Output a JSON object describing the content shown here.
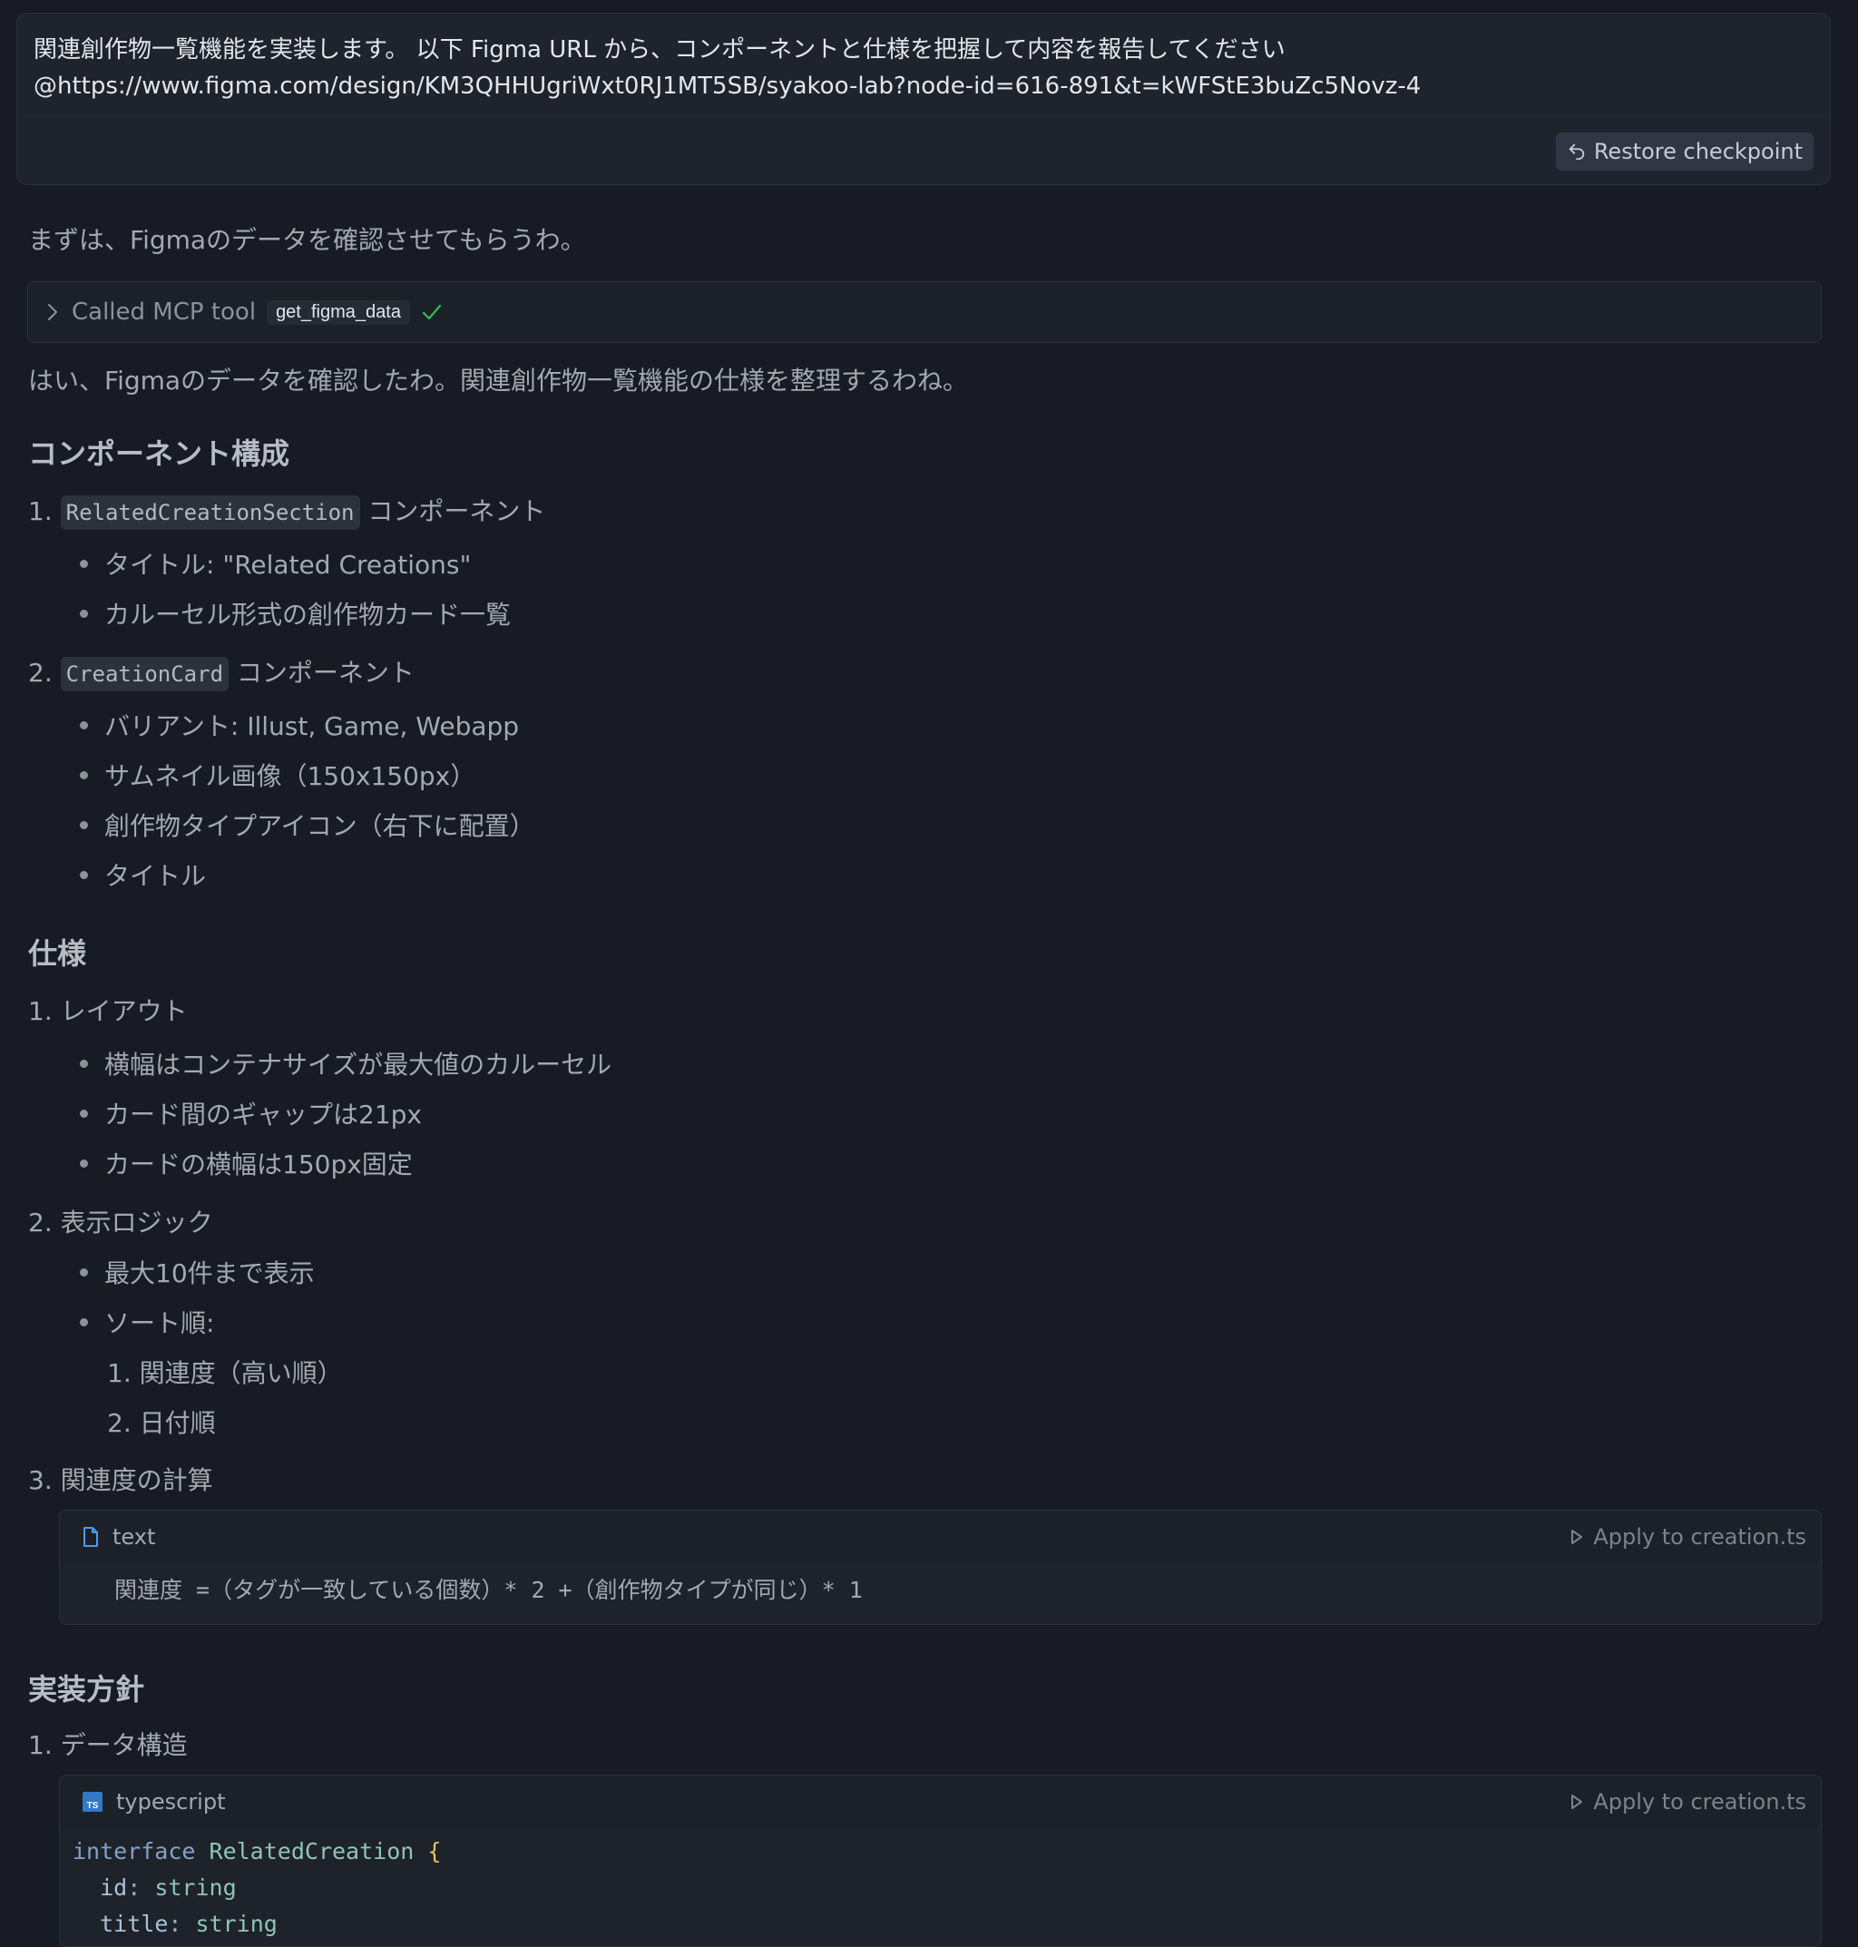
{
  "prompt": {
    "line1": "関連創作物一覧機能を実装します。 以下 Figma URL から、コンポーネントと仕様を把握して内容を報告してください",
    "line2": "@https://www.figma.com/design/KM3QHHUgriWxt0RJ1MT5SB/syakoo-lab?node-id=616-891&t=kWFStE3buZc5Novz-4",
    "restore_label": "Restore checkpoint"
  },
  "intro": "まずは、Figmaのデータを確認させてもらうわ。",
  "mcp": {
    "label": "Called MCP tool",
    "tool": "get_figma_data"
  },
  "confirm": "はい、Figmaのデータを確認したわ。関連創作物一覧機能の仕様を整理するわね。",
  "section1": {
    "heading": "コンポーネント構成",
    "item1": {
      "num": "1.",
      "code": "RelatedCreationSection",
      "suffix": " コンポーネント",
      "bullets": [
        "タイトル: \"Related Creations\"",
        "カルーセル形式の創作物カード一覧"
      ]
    },
    "item2": {
      "num": "2.",
      "code": "CreationCard",
      "suffix": " コンポーネント",
      "bullets": [
        "バリアント: Illust, Game, Webapp",
        "サムネイル画像（150x150px）",
        "創作物タイプアイコン（右下に配置）",
        "タイトル"
      ]
    }
  },
  "section2": {
    "heading": "仕様",
    "item1": {
      "label": "1. レイアウト",
      "bullets": [
        "横幅はコンテナサイズが最大値のカルーセル",
        "カード間のギャップは21px",
        "カードの横幅は150px固定"
      ]
    },
    "item2": {
      "label": "2. 表示ロジック",
      "bullets": [
        "最大10件まで表示",
        "ソート順:"
      ],
      "sub": [
        "1. 関連度（高い順）",
        "2. 日付順"
      ]
    },
    "item3": {
      "label": "3. 関連度の計算"
    }
  },
  "codeblock1": {
    "lang": "text",
    "apply": "Apply to creation.ts",
    "code": "関連度 =（タグが一致している個数）* 2 +（創作物タイプが同じ）* 1"
  },
  "section3": {
    "heading": "実装方針",
    "item1": "1. データ構造"
  },
  "codeblock2": {
    "lang": "typescript",
    "apply": "Apply to creation.ts",
    "line1": {
      "kw": "interface",
      "name": "RelatedCreation",
      "brace": "{"
    },
    "line2": {
      "prop": "id",
      "type": "string"
    },
    "line3": {
      "prop": "title",
      "type": "string"
    }
  },
  "colors": {
    "background": "#181b23",
    "card": "#1f232d",
    "check": "#3fb950",
    "ts_icon": "#3178c6",
    "file_icon": "#4d9be6"
  }
}
